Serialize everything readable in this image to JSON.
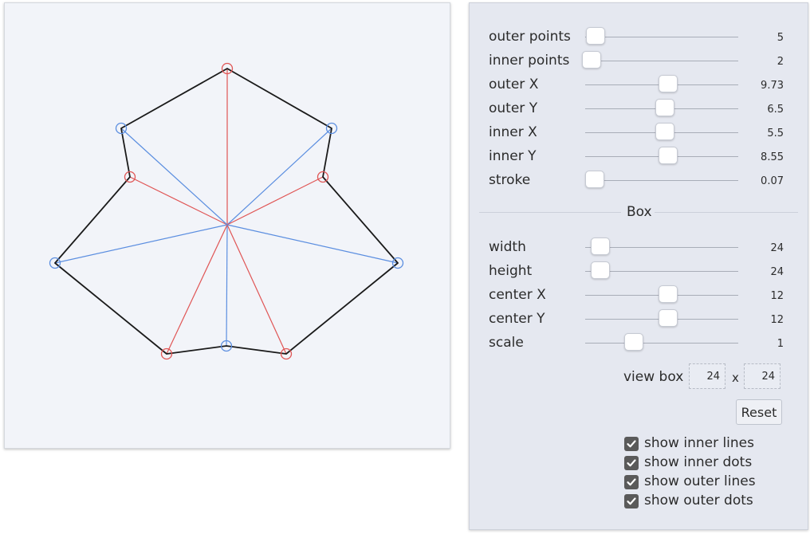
{
  "sliders": [
    {
      "id": "outer-points",
      "label": "outer points",
      "value": "5",
      "fraction": 0.07
    },
    {
      "id": "inner-points",
      "label": "inner points",
      "value": "2",
      "fraction": 0.04
    },
    {
      "id": "outer-x",
      "label": "outer X",
      "value": "9.73",
      "fraction": 0.54
    },
    {
      "id": "outer-y",
      "label": "outer Y",
      "value": "6.5",
      "fraction": 0.52
    },
    {
      "id": "inner-x",
      "label": "inner X",
      "value": "5.5",
      "fraction": 0.52
    },
    {
      "id": "inner-y",
      "label": "inner Y",
      "value": "8.55",
      "fraction": 0.54
    },
    {
      "id": "stroke",
      "label": "stroke",
      "value": "0.07",
      "fraction": 0.06
    }
  ],
  "box": {
    "title": "Box",
    "sliders": [
      {
        "id": "width",
        "label": "width",
        "value": "24",
        "fraction": 0.1
      },
      {
        "id": "height",
        "label": "height",
        "value": "24",
        "fraction": 0.1
      },
      {
        "id": "center-x",
        "label": "center X",
        "value": "12",
        "fraction": 0.54
      },
      {
        "id": "center-y",
        "label": "center Y",
        "value": "12",
        "fraction": 0.54
      },
      {
        "id": "scale",
        "label": "scale",
        "value": "1",
        "fraction": 0.32
      }
    ],
    "view_box_label": "view box",
    "view_box_width": "24",
    "view_box_separator": "x",
    "view_box_height": "24"
  },
  "reset_label": "Reset",
  "checkboxes": [
    {
      "id": "show-inner-lines",
      "label": "show inner lines",
      "checked": true
    },
    {
      "id": "show-inner-dots",
      "label": "show inner dots",
      "checked": true
    },
    {
      "id": "show-outer-lines",
      "label": "show outer lines",
      "checked": true
    },
    {
      "id": "show-outer-dots",
      "label": "show outer dots",
      "checked": true
    }
  ],
  "colors": {
    "outline": "#1a1a1a",
    "inner": "#e05555",
    "outer": "#5b8ee0",
    "canvas_bg": "#f2f4f9",
    "panel_bg": "#e5e8f0"
  }
}
